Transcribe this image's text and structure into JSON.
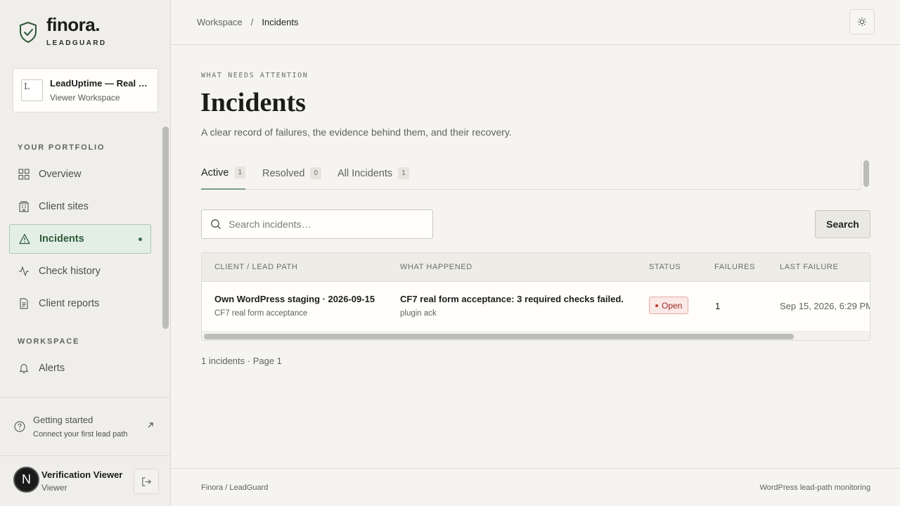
{
  "brand": {
    "name": "finora",
    "name_dot": ".",
    "sub": "LEADGUARD",
    "icon": "shield-check-icon"
  },
  "workspace": {
    "logo_letter": "L",
    "title": "LeadUptime — Real Customer",
    "role": "Viewer Workspace"
  },
  "nav": {
    "section_portfolio": "YOUR PORTFOLIO",
    "section_workspace": "WORKSPACE",
    "items": [
      {
        "label": "Overview",
        "icon": "grid-icon"
      },
      {
        "label": "Client sites",
        "icon": "building-icon"
      },
      {
        "label": "Incidents",
        "icon": "warning-triangle-icon",
        "active": true
      },
      {
        "label": "Check history",
        "icon": "activity-icon"
      },
      {
        "label": "Client reports",
        "icon": "document-icon"
      },
      {
        "label": "Alerts",
        "icon": "bell-icon"
      }
    ]
  },
  "getting_started": {
    "title": "Getting started",
    "subtitle": "Connect your first lead path"
  },
  "user": {
    "initial": "N",
    "name": "Verification Viewer",
    "role": "Viewer"
  },
  "breadcrumb": {
    "parent": "Workspace",
    "separator": "/",
    "current": "Incidents"
  },
  "page": {
    "eyebrow": "WHAT NEEDS ATTENTION",
    "title": "Incidents",
    "subtitle": "A clear record of failures, the evidence behind them, and their recovery."
  },
  "tabs": [
    {
      "label": "Active",
      "count": "1",
      "active": true
    },
    {
      "label": "Resolved",
      "count": "0"
    },
    {
      "label": "All Incidents",
      "count": "1"
    }
  ],
  "search": {
    "placeholder": "Search incidents…",
    "button_label": "Search"
  },
  "table": {
    "headers": [
      "CLIENT / LEAD PATH",
      "WHAT HAPPENED",
      "STATUS",
      "FAILURES",
      "LAST FAILURE"
    ],
    "rows": [
      {
        "client": "Own WordPress staging · 2026-09-15",
        "lead_path": "CF7 real form acceptance",
        "what_happened": "CF7 real form acceptance: 3 required checks failed.",
        "detail": "plugin ack",
        "status": "Open",
        "failures": "1",
        "last_failure": "Sep 15, 2026, 6:29 PM"
      }
    ]
  },
  "pager": "1 incidents · Page 1",
  "footer": {
    "left": "Finora / LeadGuard",
    "right": "WordPress lead-path monitoring"
  },
  "colors": {
    "accent": "#3c6a48",
    "active_bg": "#e3efe5",
    "status_open": "#9a2a22"
  }
}
